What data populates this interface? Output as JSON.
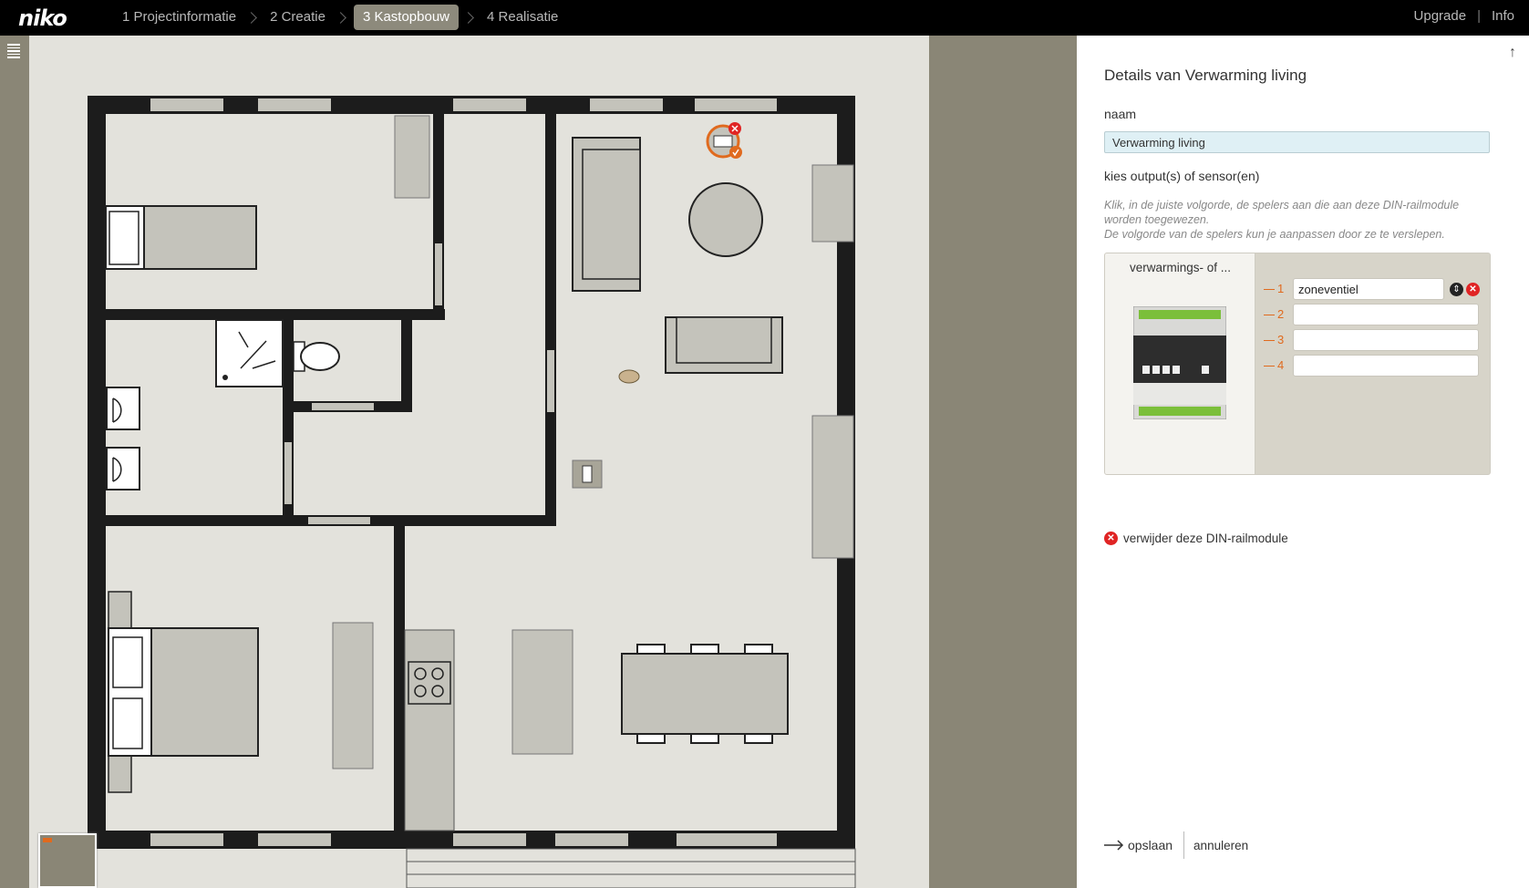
{
  "topbar": {
    "logo": "niko",
    "steps": [
      {
        "label": "1 Projectinformatie"
      },
      {
        "label": "2 Creatie"
      },
      {
        "label": "3 Kastopbouw"
      },
      {
        "label": "4 Realisatie"
      }
    ],
    "active_step": 2,
    "links": {
      "upgrade": "Upgrade",
      "separator": "|",
      "info": "Info"
    }
  },
  "panel": {
    "scroll_top_icon": "arrow-up-icon",
    "title": "Details van Verwarming living",
    "name_label": "naam",
    "name_value": "Verwarming living",
    "outputs_label": "kies output(s) of sensor(en)",
    "hint_line1": "Klik, in de juiste volgorde, de spelers aan die aan deze DIN-railmodule worden toegewezen.",
    "hint_line2": "De volgorde van de spelers kun je aanpassen door ze te verslepen.",
    "module": {
      "title": "verwarmings- of ...",
      "slots": [
        {
          "num": "1",
          "value": "zoneventiel"
        },
        {
          "num": "2",
          "value": ""
        },
        {
          "num": "3",
          "value": ""
        },
        {
          "num": "4",
          "value": ""
        }
      ]
    },
    "remove_label": "verwijder deze DIN-railmodule",
    "save_label": "opslaan",
    "cancel_label": "annuleren"
  },
  "colors": {
    "topbar": "#000000",
    "accent_orange": "#e06a1e",
    "active_step": "#8d8a7c",
    "wall": "#1c1c1c",
    "floor": "#e3e2dc",
    "furniture": "#c4c3bb",
    "side_band": "#8a8676",
    "delete_red": "#e02424"
  }
}
